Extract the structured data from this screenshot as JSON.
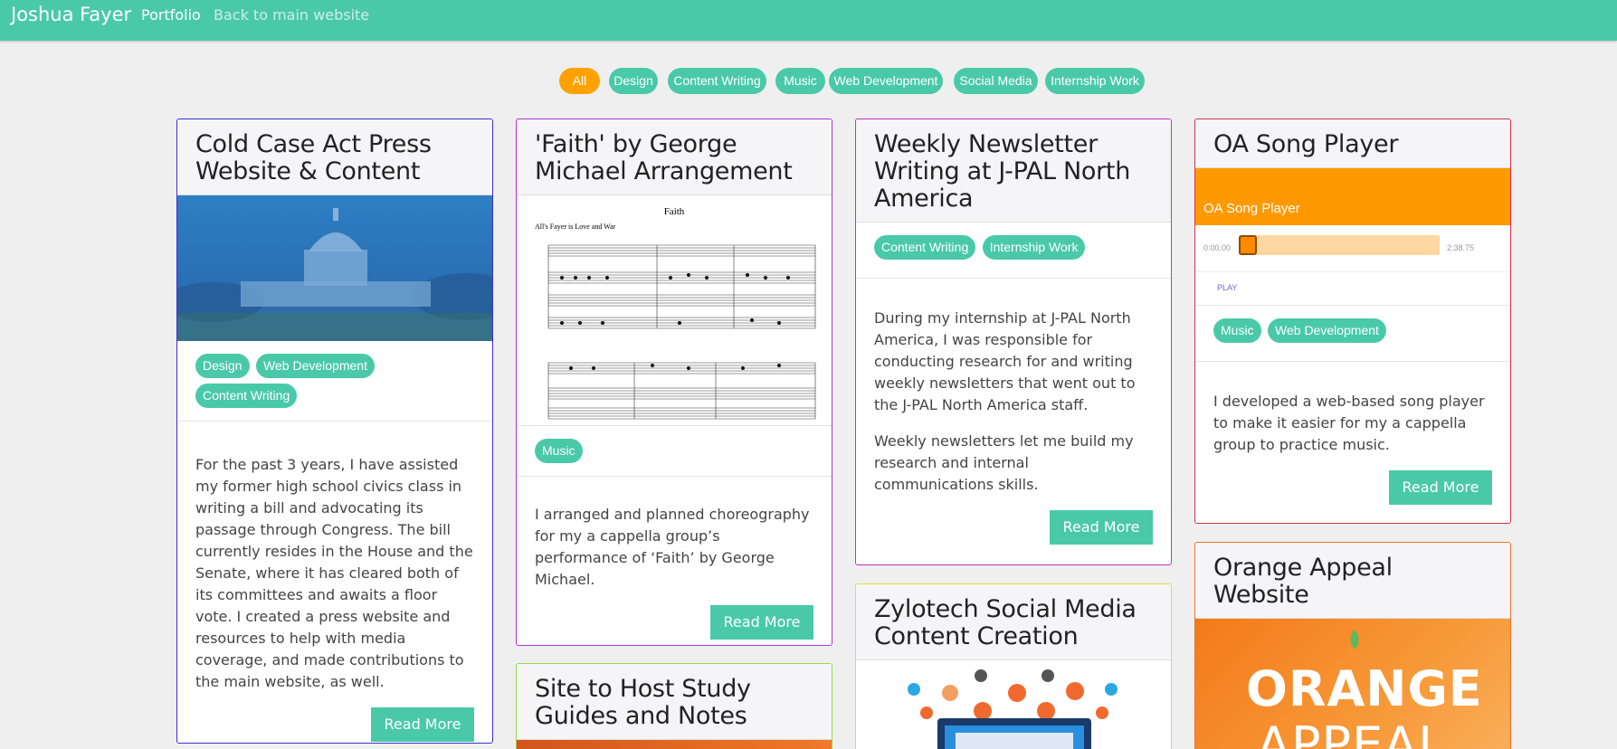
{
  "nav": {
    "brand": "Joshua Fayer",
    "portfolio": "Portfolio",
    "back": "Back to main website"
  },
  "filters": [
    "All",
    "Design",
    "Content Writing",
    "Music",
    "Web Development",
    "Social Media",
    "Internship Work"
  ],
  "colors": {
    "accent": "#4ac9a8",
    "active_filter": "#ffa200",
    "background": "#efefef"
  },
  "cards": {
    "coldcase": {
      "title": "Cold Case Act Press Website & Content",
      "border": "#3a2fd1",
      "tags": [
        "Design",
        "Web Development",
        "Content Writing"
      ],
      "body": "For the past 3 years, I have assisted my former high school civics class in writing a bill and advocating its passage through Congress. The bill currently resides in the House and the Senate, where it has cleared both of its committees and awaits a floor vote. I created a press website and resources to help with media coverage, and made contributions to the main website, as well.",
      "button": "Read More"
    },
    "faith": {
      "title": "'Faith' by George Michael Arrangement",
      "border": "#b030d8",
      "sheet_title": "Faith",
      "sheet_sub": "All's Fayer is Love and War",
      "tags": [
        "Music"
      ],
      "body": "I arranged and planned choreography for my a cappella group’s performance of ‘Faith’ by George Michael.",
      "button": "Read More"
    },
    "jpal": {
      "title": "Weekly Newsletter Writing at J-PAL North America",
      "border": "#c030c0",
      "tags": [
        "Content Writing",
        "Internship Work"
      ],
      "body1": "During my internship at J-PAL North America, I was responsible for conducting research for and writing weekly newsletters that went out to the J-PAL North America staff.",
      "body2": "Weekly newsletters let me build my research and internal communications skills.",
      "button": "Read More"
    },
    "oa": {
      "title": "OA Song Player",
      "border": "#d8304a",
      "player_title": "OA Song Player",
      "time_current": "0:00.00",
      "time_total": "2:38.75",
      "play_label": "PLAY",
      "progress": 0,
      "tags": [
        "Music",
        "Web Development"
      ],
      "body": "I developed a web-based song player to make it easier for my a cappella group to practice music.",
      "button": "Read More"
    },
    "study": {
      "title": "Site to Host Study Guides and Notes",
      "border": "#9bd84a"
    },
    "zylotech": {
      "title": "Zylotech Social Media Content Creation",
      "border": "#e8d84a"
    },
    "orange": {
      "title": "Orange Appeal Website",
      "border": "#e8732a",
      "logo_line1": "ORANGE",
      "logo_line2": "APPEAL"
    }
  }
}
